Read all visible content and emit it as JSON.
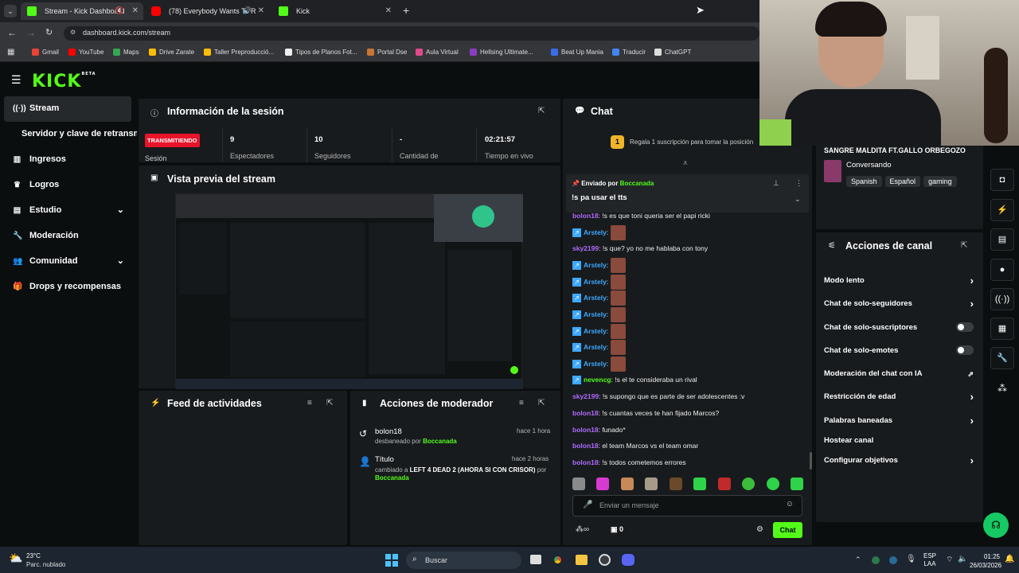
{
  "browser": {
    "tabs": [
      {
        "title": "Stream - Kick Dashboard"
      },
      {
        "title": "(78) Everybody Wants To R"
      },
      {
        "title": "Kick"
      }
    ],
    "url": "dashboard.kick.com/stream",
    "bookmarks": [
      "Gmail",
      "YouTube",
      "Maps",
      "Drive Zarate",
      "Taller Preproducció...",
      "Tipos de Planos Fot...",
      "Portal Dse",
      "Aula Virtual",
      "Hellsing Ultimate...",
      "Beat Up Mania",
      "Traducir",
      "ChatGPT"
    ]
  },
  "app": {
    "logo": "KICK",
    "logo_badge": "BETA"
  },
  "sidebar": {
    "items": [
      {
        "label": "Stream",
        "icon": "signal-icon"
      },
      {
        "label": "Servidor y clave de retransm"
      },
      {
        "label": "Ingresos",
        "icon": "chart-icon"
      },
      {
        "label": "Logros",
        "icon": "trophy-icon"
      },
      {
        "label": "Estudio",
        "icon": "layout-icon"
      },
      {
        "label": "Moderación",
        "icon": "wrench-icon"
      },
      {
        "label": "Comunidad",
        "icon": "people-icon"
      },
      {
        "label": "Drops y recompensas",
        "icon": "gift-icon"
      }
    ]
  },
  "session": {
    "title": "Información de la sesión",
    "status": "TRANSMITIENDO",
    "status_sub": "Sesión",
    "stats": [
      {
        "value": "9",
        "label": "Espectadores"
      },
      {
        "value": "10",
        "label": "Seguidores"
      },
      {
        "value": "-",
        "label": "Cantidad de"
      },
      {
        "value": "02:21:57",
        "label": "Tiempo en vivo"
      }
    ]
  },
  "preview": {
    "title": "Vista previa del stream"
  },
  "feed": {
    "title": "Feed de actividades"
  },
  "modactions": {
    "title": "Acciones de moderador",
    "items": [
      {
        "user": "bolon18",
        "time": "hace 1 hora",
        "action": "desbaneado por",
        "by": "Boccanada"
      },
      {
        "user": "Título",
        "time": "hace 2 horas",
        "action": "cambiado a",
        "value": "LEFT 4 DEAD 2 (AHORA SI CON CRISOR)",
        "by_prefix": "por",
        "by": "Boccanada"
      }
    ]
  },
  "chat": {
    "title": "Chat",
    "promo_count": "1",
    "promo": "Regala 1 suscripción para tomar la posición",
    "pinned_label": "Enviado por",
    "pinned_user": "Boccanada",
    "pinned_msg": "!s pa usar el tts",
    "messages": [
      {
        "user": "bolon18",
        "text": ": !s es que toni queria ser el papi ricki"
      },
      {
        "user": "Arstely",
        "text": ":"
      },
      {
        "user": "sky2199",
        "text": ": !s que? yo no me hablaba con tony"
      },
      {
        "user": "Arstely",
        "text": ":"
      },
      {
        "user": "Arstely",
        "text": ":"
      },
      {
        "user": "Arstely",
        "text": ":"
      },
      {
        "user": "Arstely",
        "text": ":"
      },
      {
        "user": "Arstely",
        "text": ":"
      },
      {
        "user": "Arstely",
        "text": ":"
      },
      {
        "user": "Arstely",
        "text": ":"
      },
      {
        "user": "nevencg",
        "text": ": !s el te consideraba un rival"
      },
      {
        "user": "sky2199",
        "text": ": !s supongo que es parte de ser adolescentes :v"
      },
      {
        "user": "bolon18",
        "text": ": !s cuantas veces te han fijado Marcos?"
      },
      {
        "user": "bolon18",
        "text": ": funado*"
      },
      {
        "user": "bolon18",
        "text": ": el team Marcos vs el team omar"
      },
      {
        "user": "bolon18",
        "text": ": !s todos cometemos errores"
      }
    ],
    "input_placeholder": "Enviar un mensaje",
    "points": "0",
    "send_label": "Chat"
  },
  "stream_info": {
    "title": "SANGRE MALDITA FT.GALLO ORBEGOZO",
    "category": "Conversando",
    "tags": [
      "Spanish",
      "Español",
      "gaming"
    ]
  },
  "channel_actions": {
    "title": "Acciones de canal",
    "items": [
      {
        "label": "Modo lento",
        "type": "chevron"
      },
      {
        "label": "Chat de solo-seguidores",
        "type": "chevron"
      },
      {
        "label": "Chat de solo-suscriptores",
        "type": "toggle"
      },
      {
        "label": "Chat de solo-emotes",
        "type": "toggle"
      },
      {
        "label": "Moderación del chat con IA",
        "type": "external"
      },
      {
        "label": "Restricción de edad",
        "type": "chevron"
      },
      {
        "label": "Palabras baneadas",
        "type": "chevron"
      },
      {
        "label": "Hostear canal",
        "type": "none"
      },
      {
        "label": "Configurar objetivos",
        "type": "chevron"
      }
    ]
  },
  "taskbar": {
    "weather_temp": "23°C",
    "weather_desc": "Parc. nublado",
    "search": "Buscar",
    "lang1": "ESP",
    "lang2": "LAA",
    "time": "01:25",
    "date": "26/03/2026"
  },
  "colors": {
    "accent": "#53fc18",
    "live": "#e8142a",
    "bg": "#0b0e0f",
    "panel": "#181b1d"
  }
}
